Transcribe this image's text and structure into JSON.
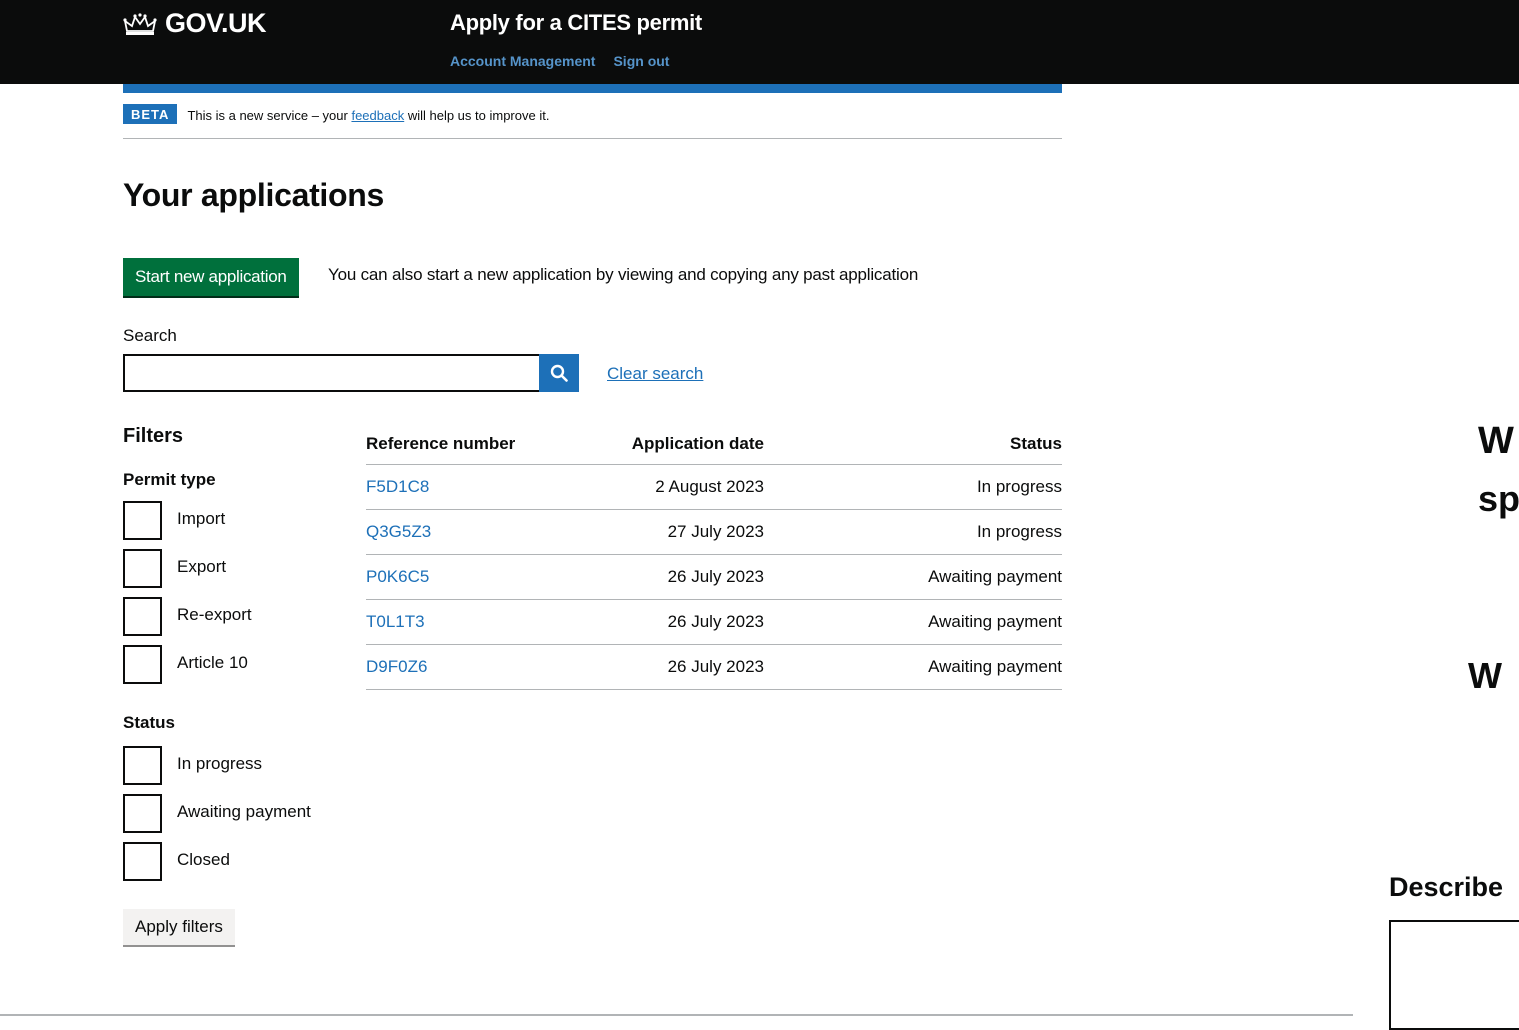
{
  "header": {
    "logo_text": "GOV.UK",
    "service_name": "Apply for a CITES permit",
    "nav": [
      "Account Management",
      "Sign out"
    ]
  },
  "phase_banner": {
    "tag": "BETA",
    "text_before": "This is a new service – your ",
    "link": "feedback",
    "text_after": " will help us to improve it."
  },
  "page_title": "Your applications",
  "start": {
    "button_label": "Start new application",
    "hint": "You can also start a new application by viewing and copying any past application"
  },
  "search": {
    "label": "Search",
    "value": "",
    "button_icon": "search-icon",
    "clear_label": "Clear search"
  },
  "filters": {
    "title": "Filters",
    "permit_type": {
      "title": "Permit type",
      "options": [
        "Import",
        "Export",
        "Re-export",
        "Article 10"
      ]
    },
    "status": {
      "title": "Status",
      "options": [
        "In progress",
        "Awaiting payment",
        "Closed"
      ]
    },
    "apply_label": "Apply filters"
  },
  "table": {
    "headers": [
      "Reference number",
      "Application date",
      "Status"
    ],
    "rows": [
      {
        "ref": "F5D1C8",
        "date": "2 August 2023",
        "status": "In progress"
      },
      {
        "ref": "Q3G5Z3",
        "date": "27 July 2023",
        "status": "In progress"
      },
      {
        "ref": "P0K6C5",
        "date": "26 July 2023",
        "status": "Awaiting payment"
      },
      {
        "ref": "T0L1T3",
        "date": "26 July 2023",
        "status": "Awaiting payment"
      },
      {
        "ref": "D9F0Z6",
        "date": "26 July 2023",
        "status": "Awaiting payment"
      }
    ]
  },
  "background_page": {
    "fragments": [
      "W",
      "sp",
      "W",
      "Describe"
    ]
  },
  "colors": {
    "header_bg": "#0b0c0c",
    "brand_blue": "#1d70b8",
    "start_green": "#00703c",
    "link": "#1d70b8"
  }
}
